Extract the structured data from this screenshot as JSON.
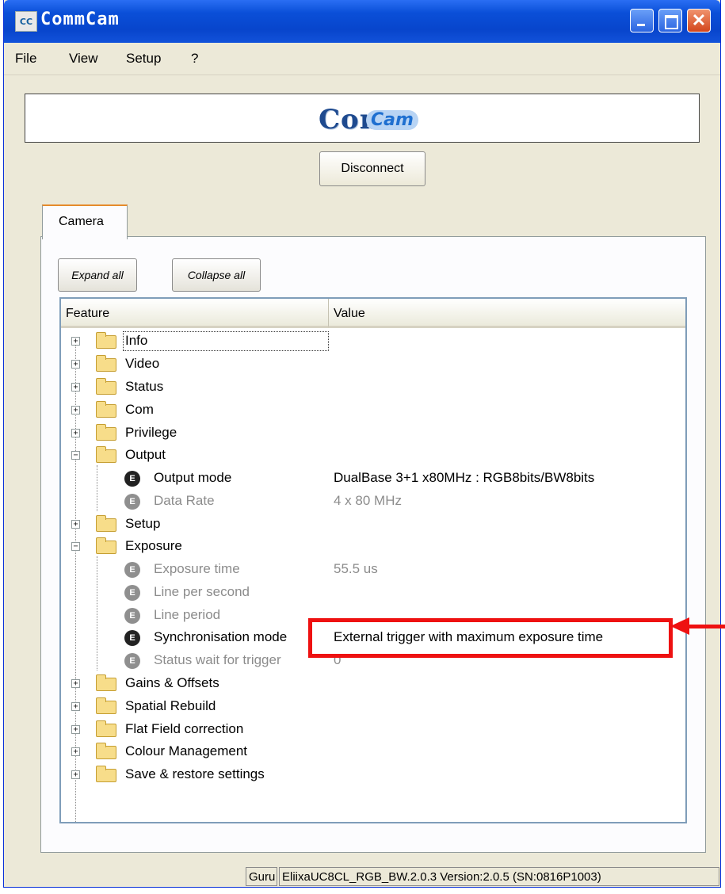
{
  "window": {
    "title": "CommCam",
    "icon_text": "CC",
    "buttons": {
      "minimize": "minimize-icon",
      "maximize": "maximize-icon",
      "close": "close-icon"
    }
  },
  "menu": [
    "File",
    "View",
    "Setup",
    "?"
  ],
  "logo": {
    "main": "Com",
    "sub": "Cam"
  },
  "disconnect_label": "Disconnect",
  "tab_label": "Camera",
  "expand_all_label": "Expand all",
  "collapse_all_label": "Collapse all",
  "tree": {
    "headers": {
      "feature": "Feature",
      "value": "Value"
    },
    "rows": [
      {
        "label": "Info"
      },
      {
        "label": "Video"
      },
      {
        "label": "Status"
      },
      {
        "label": "Com"
      },
      {
        "label": "Privilege"
      },
      {
        "label": "Output"
      },
      {
        "label": "Output mode",
        "value": "DualBase 3+1 x80MHz : RGB8bits/BW8bits"
      },
      {
        "label": "Data Rate",
        "value": "4 x 80 MHz"
      },
      {
        "label": "Setup"
      },
      {
        "label": "Exposure"
      },
      {
        "label": "Exposure time",
        "value": "55.5 us"
      },
      {
        "label": "Line per second"
      },
      {
        "label": "Line period"
      },
      {
        "label": "Synchronisation mode",
        "value": "External trigger with maximum exposure time"
      },
      {
        "label": "Status wait for trigger",
        "value": "0"
      },
      {
        "label": "Gains & Offsets"
      },
      {
        "label": "Spatial Rebuild"
      },
      {
        "label": "Flat Field correction"
      },
      {
        "label": "Colour Management"
      },
      {
        "label": "Save & restore settings"
      }
    ]
  },
  "statusbar": {
    "user": "Guru",
    "info": "EliixaUC8CL_RGB_BW.2.0.3 Version:2.0.5 (SN:0816P1003)"
  },
  "colors": {
    "highlight": "#ee1111",
    "titlebar": "#0a4fd8"
  }
}
